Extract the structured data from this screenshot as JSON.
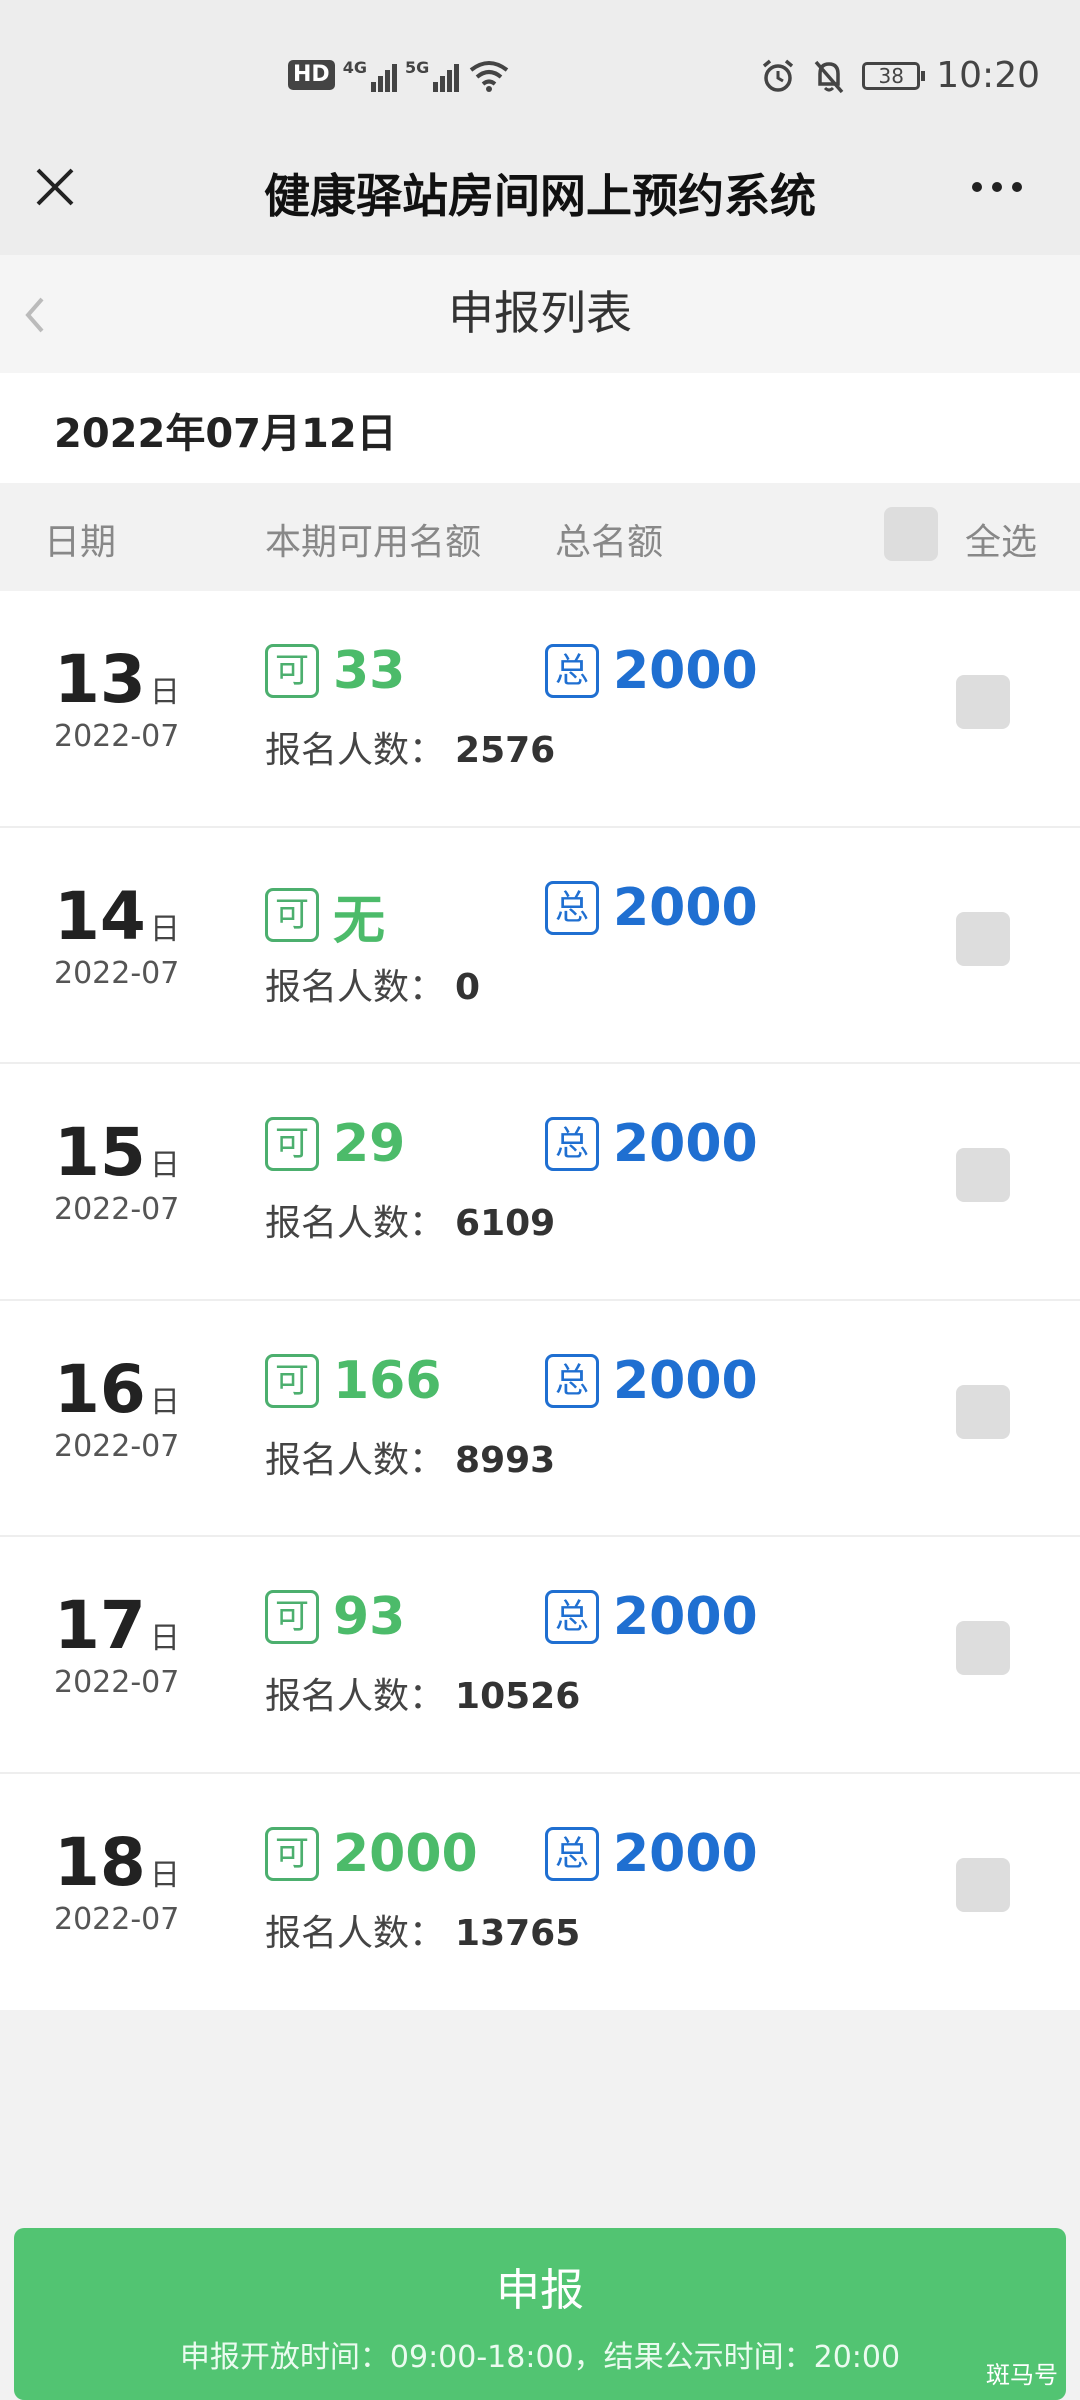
{
  "status_bar": {
    "hd": "HD",
    "net1": "4G",
    "net2": "5G",
    "battery": "38",
    "time": "10:20"
  },
  "title_bar": {
    "title": "健康驿站房间网上预约系统"
  },
  "sub_header": {
    "title": "申报列表"
  },
  "date": "2022年07月12日",
  "columns": {
    "date": "日期",
    "available": "本期可用名额",
    "total": "总名额",
    "select_all": "全选"
  },
  "tags": {
    "available": "可",
    "total": "总",
    "day_unit": "日",
    "enroll_label": "报名人数："
  },
  "rows": [
    {
      "day": "13",
      "ym": "2022-07",
      "available": "33",
      "total": "2000",
      "enrolled": "2576"
    },
    {
      "day": "14",
      "ym": "2022-07",
      "available": "无",
      "total": "2000",
      "enrolled": "0"
    },
    {
      "day": "15",
      "ym": "2022-07",
      "available": "29",
      "total": "2000",
      "enrolled": "6109"
    },
    {
      "day": "16",
      "ym": "2022-07",
      "available": "166",
      "total": "2000",
      "enrolled": "8993"
    },
    {
      "day": "17",
      "ym": "2022-07",
      "available": "93",
      "total": "2000",
      "enrolled": "10526"
    },
    {
      "day": "18",
      "ym": "2022-07",
      "available": "2000",
      "total": "2000",
      "enrolled": "13765"
    }
  ],
  "footer": {
    "button": "申报",
    "note": "申报开放时间：09:00-18:00，结果公示时间：20:00",
    "watermark": "斑马号"
  },
  "colors": {
    "available_green": "#4cbb6a",
    "total_blue": "#1f6fd1",
    "button_green": "#52c472"
  }
}
